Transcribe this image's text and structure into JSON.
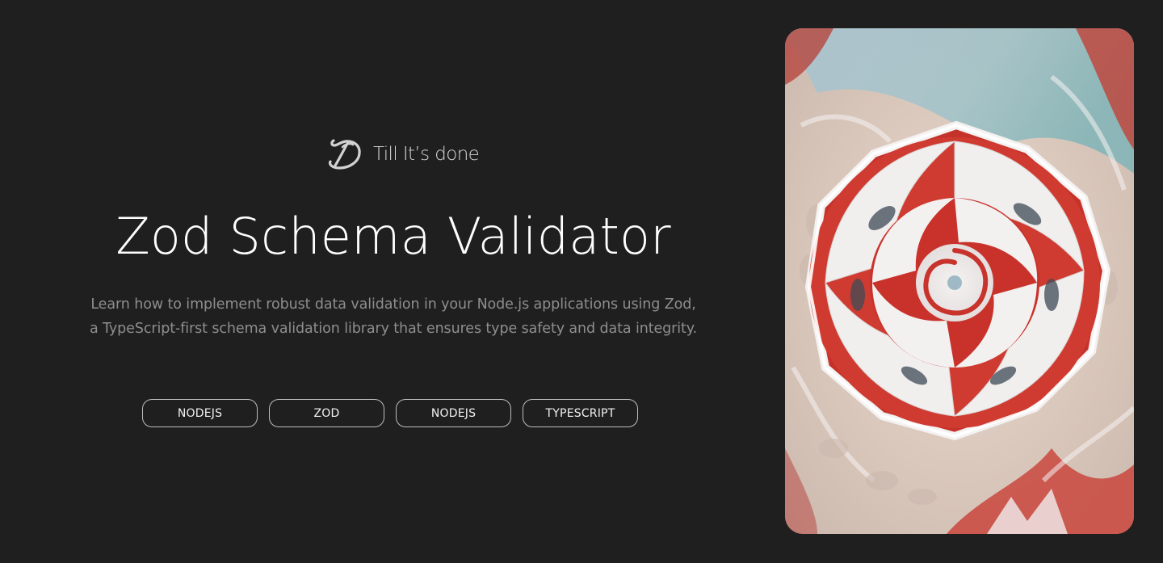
{
  "brand": {
    "logo_icon": "signature-logo-icon",
    "name": "Till It’s done"
  },
  "hero": {
    "title": "Zod Schema Validator",
    "description_line1": "Learn how to implement robust data validation in your Node.js applications using Zod,",
    "description_line2": "a TypeScript-first schema validation library that ensures type safety and data integrity."
  },
  "tags": [
    {
      "label": "NODEJS"
    },
    {
      "label": "ZOD"
    },
    {
      "label": "NODEJS"
    },
    {
      "label": "TYPESCRIPT"
    }
  ],
  "image": {
    "subject": "abstract-red-white-spiral-artwork",
    "colors": {
      "accent_red": "#c42a22",
      "snow_white": "#eceaea",
      "sand": "#d8c7bc",
      "ice_blue": "#8fb6c6"
    }
  },
  "colors": {
    "background": "#1f1f1f",
    "title": "#ffffff",
    "body_text": "#8e8e8e",
    "tag_border": "#bdbdbd"
  }
}
